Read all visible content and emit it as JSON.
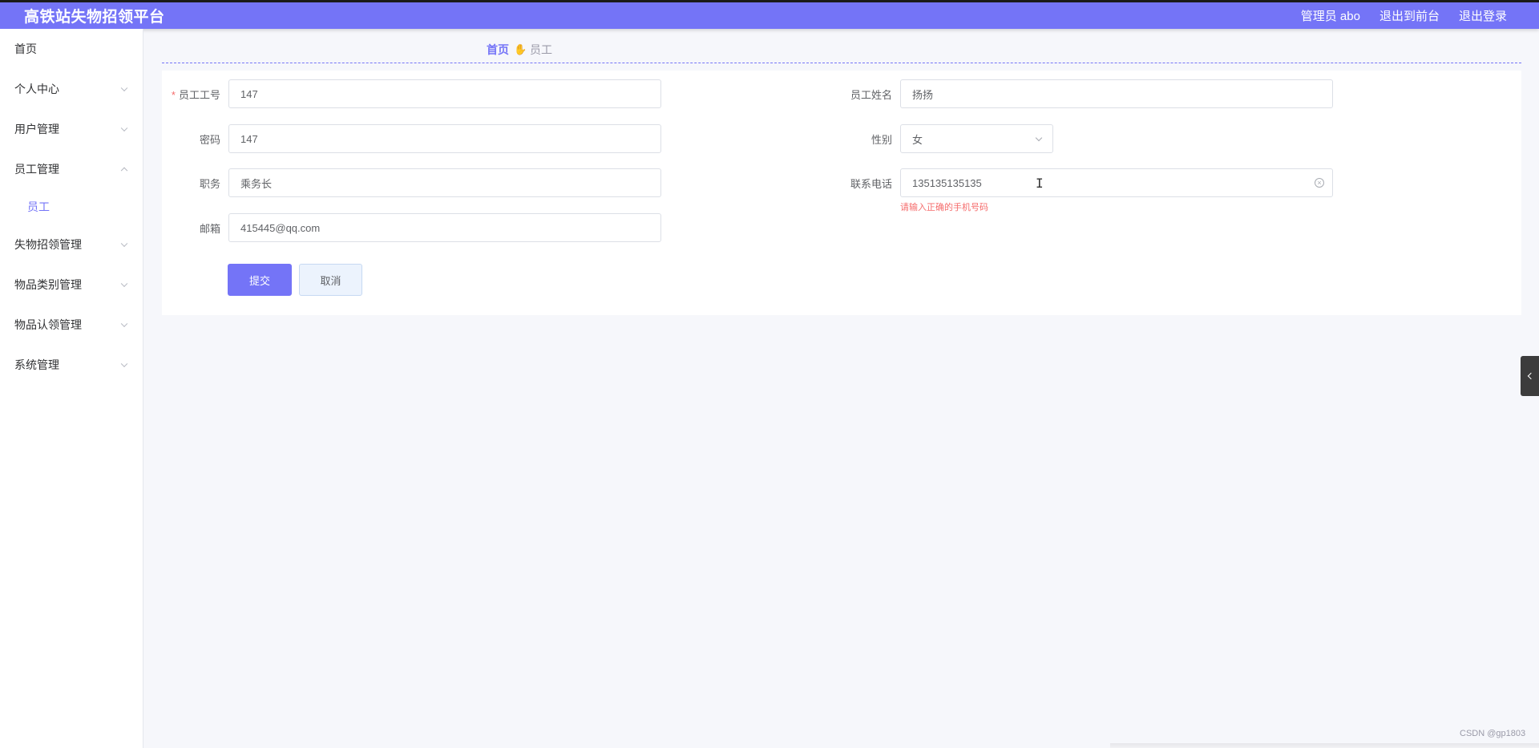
{
  "header": {
    "title": "高铁站失物招领平台",
    "user": "管理员 abo",
    "to_front": "退出到前台",
    "logout": "退出登录"
  },
  "sidebar": {
    "items": [
      {
        "label": "首页"
      },
      {
        "label": "个人中心"
      },
      {
        "label": "用户管理"
      },
      {
        "label": "员工管理"
      },
      {
        "label": "员工"
      },
      {
        "label": "失物招领管理"
      },
      {
        "label": "物品类别管理"
      },
      {
        "label": "物品认领管理"
      },
      {
        "label": "系统管理"
      }
    ]
  },
  "breadcrumb": {
    "home": "首页",
    "current": "员工"
  },
  "form": {
    "employee_id": {
      "label": "员工工号",
      "value": "147",
      "required_mark": "*"
    },
    "password": {
      "label": "密码",
      "value": "147"
    },
    "position": {
      "label": "职务",
      "value": "乘务长"
    },
    "email": {
      "label": "邮箱",
      "value": "415445@qq.com"
    },
    "name": {
      "label": "员工姓名",
      "value": "扬扬"
    },
    "gender": {
      "label": "性别",
      "value": "女"
    },
    "phone": {
      "label": "联系电话",
      "value": "135135135135",
      "error": "请输入正确的手机号码"
    },
    "submit_label": "提交",
    "cancel_label": "取消"
  },
  "watermark": "CSDN @gp1803",
  "icons": {
    "chevron": "chevron-down-icon",
    "breadcrumb_sep": "hand-icon",
    "clear": "clear-circle-icon",
    "collapse": "chevron-left-icon"
  },
  "colors": {
    "primary": "#7474f7",
    "error": "#f56c6c"
  }
}
